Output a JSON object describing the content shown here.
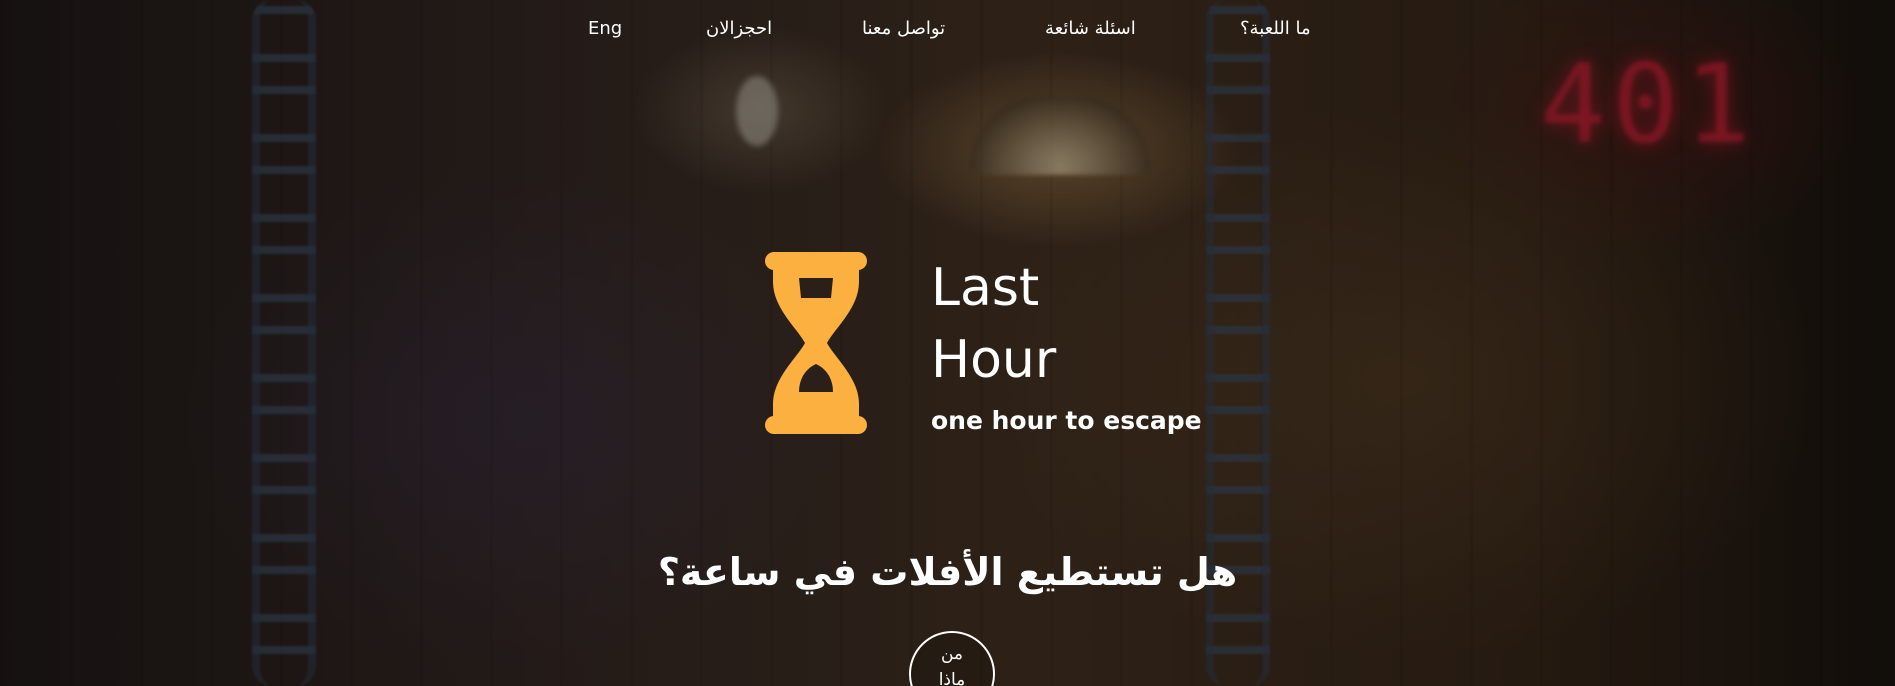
{
  "nav": {
    "items": [
      {
        "label": "Eng"
      },
      {
        "label": "احجزالان"
      },
      {
        "label": "تواصل معنا"
      },
      {
        "label": "اسئلة شائعة"
      },
      {
        "label": "ما اللعبة؟"
      }
    ]
  },
  "logo": {
    "icon": "hourglass-icon",
    "title_line1": "Last",
    "title_line2": "Hour",
    "tagline": "one hour to escape",
    "accent_color": "#FBB040"
  },
  "background": {
    "display_text": "401"
  },
  "hero": {
    "headline": "هل تستطيع الأفلات في ساعة؟",
    "circle_button_line1": "من",
    "circle_button_line2": "ماذا"
  }
}
